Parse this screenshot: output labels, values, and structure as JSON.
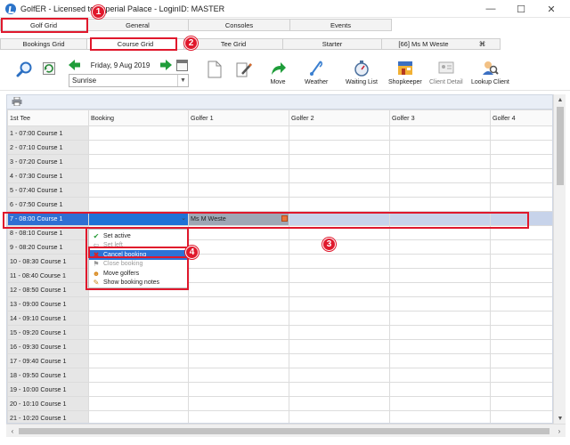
{
  "window": {
    "title": "GolfER - Licensed to Imperial Palace - LoginID: MASTER",
    "minimize": "—",
    "maximize": "☐",
    "close": "✕"
  },
  "main_tabs": [
    {
      "label": "Golf Grid",
      "active": true
    },
    {
      "label": "General",
      "active": false
    },
    {
      "label": "Consoles",
      "active": false
    },
    {
      "label": "Events",
      "active": false
    }
  ],
  "sub_tabs": [
    {
      "label": "Bookings Grid",
      "active": false
    },
    {
      "label": "Course Grid",
      "active": true
    },
    {
      "label": "Tee Grid",
      "active": false
    },
    {
      "label": "Starter",
      "active": false
    },
    {
      "label": "[66] Ms M Weste",
      "active": false
    }
  ],
  "sub_tab_close": "⌘",
  "date_nav": {
    "date": "Friday, 9 Aug 2019",
    "period": "Sunrise"
  },
  "toolbar": {
    "move": "Move",
    "weather": "Weather",
    "waiting_list": "Waiting List",
    "shopkeeper": "Shopkeeper",
    "client_detail": "Client Detail",
    "lookup_client": "Lookup Client"
  },
  "grid": {
    "columns": [
      "1st Tee",
      "Booking",
      "Golfer 1",
      "Golfer 2",
      "Golfer 3",
      "Golfer 4"
    ],
    "rows": [
      {
        "tee": "1 - 07:00  Course 1",
        "golfer1": ""
      },
      {
        "tee": "2 - 07:10  Course 1",
        "golfer1": ""
      },
      {
        "tee": "3 - 07:20  Course 1",
        "golfer1": ""
      },
      {
        "tee": "4 - 07:30  Course 1",
        "golfer1": ""
      },
      {
        "tee": "5 - 07:40  Course 1",
        "golfer1": ""
      },
      {
        "tee": "6 - 07:50  Course 1",
        "golfer1": ""
      },
      {
        "tee": "7 - 08:00  Course 1",
        "golfer1": "Ms M Weste"
      },
      {
        "tee": "8 - 08:10  Course 1",
        "golfer1": ""
      },
      {
        "tee": "9 - 08:20  Course 1",
        "golfer1": ""
      },
      {
        "tee": "10 - 08:30  Course 1",
        "golfer1": ""
      },
      {
        "tee": "11 - 08:40  Course 1",
        "golfer1": ""
      },
      {
        "tee": "12 - 08:50  Course 1",
        "golfer1": ""
      },
      {
        "tee": "13 - 09:00  Course 1",
        "golfer1": ""
      },
      {
        "tee": "14 - 09:10  Course 1",
        "golfer1": ""
      },
      {
        "tee": "15 - 09:20  Course 1",
        "golfer1": ""
      },
      {
        "tee": "16 - 09:30  Course 1",
        "golfer1": ""
      },
      {
        "tee": "17 - 09:40  Course 1",
        "golfer1": ""
      },
      {
        "tee": "18 - 09:50  Course 1",
        "golfer1": ""
      },
      {
        "tee": "19 - 10:00  Course 1",
        "golfer1": ""
      },
      {
        "tee": "20 - 10:10  Course 1",
        "golfer1": ""
      },
      {
        "tee": "21 - 10:20  Course 1",
        "golfer1": ""
      }
    ],
    "selected_row_index": 6
  },
  "context_menu": {
    "items": [
      {
        "label": "Set active",
        "icon": "check-icon",
        "disabled": false,
        "highlight": false
      },
      {
        "label": "Set left",
        "icon": "left-icon",
        "disabled": true,
        "highlight": false
      },
      {
        "label": "Cancel booking",
        "icon": "cancel-icon",
        "disabled": false,
        "highlight": true
      },
      {
        "label": "Close booking",
        "icon": "close-booking-icon",
        "disabled": true,
        "highlight": false
      },
      {
        "label": "Move golfers",
        "icon": "move-golfers-icon",
        "disabled": false,
        "highlight": false
      },
      {
        "label": "Show booking notes",
        "icon": "notes-icon",
        "disabled": false,
        "highlight": false
      }
    ]
  },
  "callouts": [
    "1",
    "2",
    "3",
    "4"
  ],
  "colors": {
    "callout": "#e0182c",
    "selection": "#2d72d6",
    "selected_row": "#c7d3ea"
  }
}
